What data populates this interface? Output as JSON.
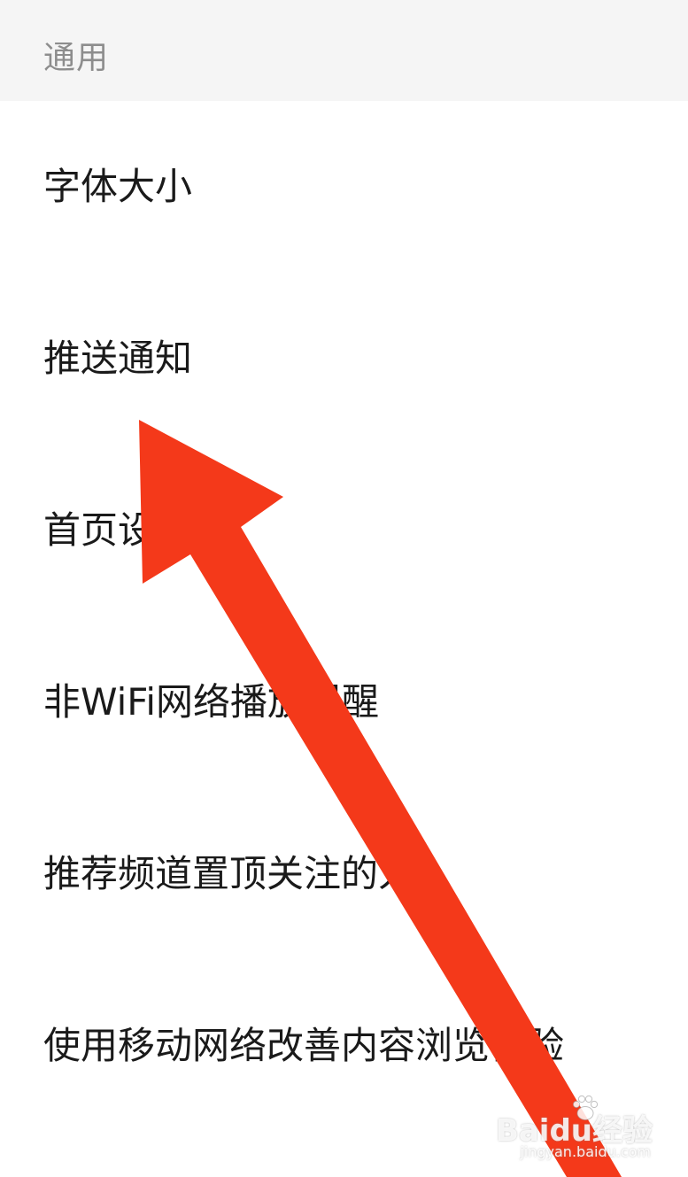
{
  "section": {
    "title": "通用"
  },
  "settings": {
    "items": [
      {
        "label": "字体大小"
      },
      {
        "label": "推送通知"
      },
      {
        "label": "首页设置"
      },
      {
        "label": "非WiFi网络播放提醒"
      },
      {
        "label": "推荐频道置顶关注的人"
      },
      {
        "label": "使用移动网络改善内容浏览体验"
      }
    ]
  },
  "annotation": {
    "arrow_color": "#f4391a",
    "icon": "arrow-up-left-icon"
  },
  "watermark": {
    "brand": "Baidu经验",
    "url": "jingyan.baidu.com",
    "icon": "paw-icon"
  }
}
